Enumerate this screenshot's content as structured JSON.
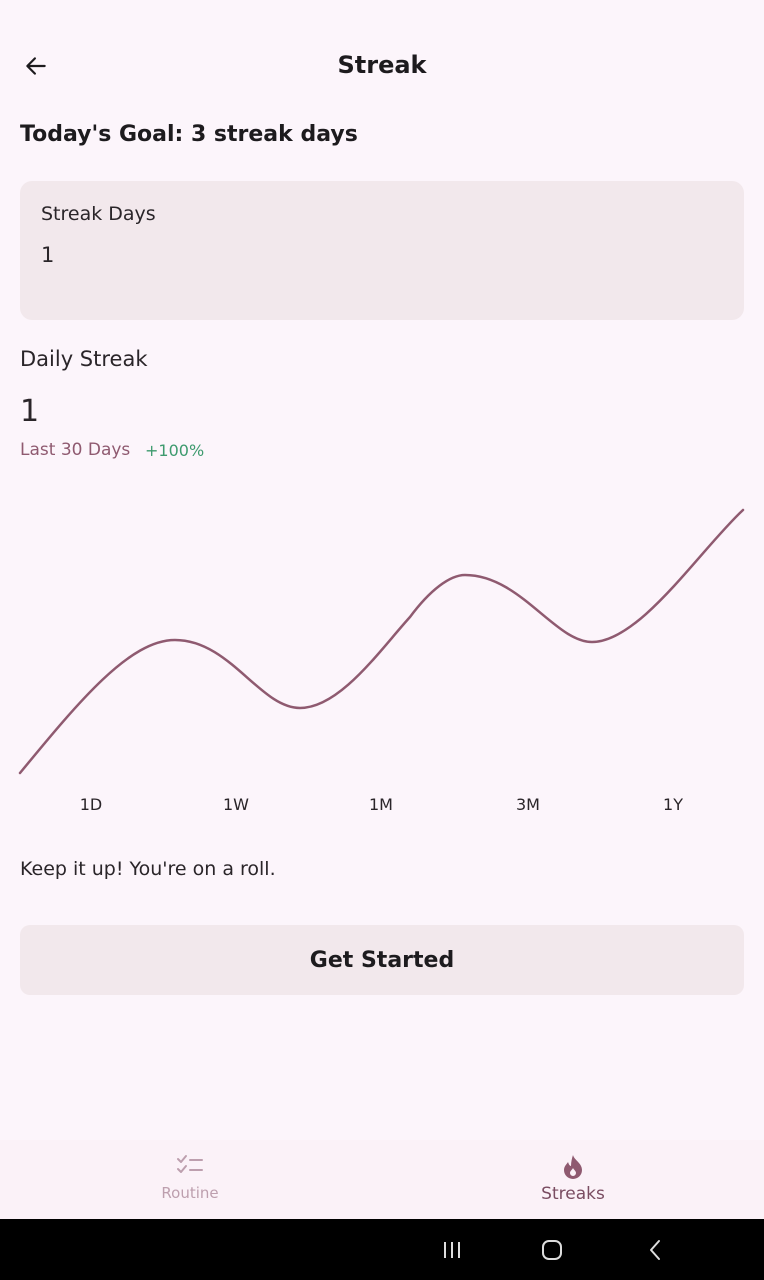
{
  "app_bar": {
    "title": "Streak"
  },
  "goal": {
    "text": "Today's Goal: 3 streak days"
  },
  "streak_card": {
    "label": "Streak Days",
    "value": "1"
  },
  "daily": {
    "label": "Daily Streak",
    "value": "1",
    "period": "Last 30 Days",
    "change": "+100%"
  },
  "chart_data": {
    "type": "line",
    "title": "",
    "xlabel": "",
    "ylabel": "",
    "grid": false,
    "categories": [
      "1D",
      "1W",
      "1M",
      "3M",
      "1Y"
    ],
    "color": "#8f5a70"
  },
  "message": "Keep it up! You're on a roll.",
  "cta": {
    "label": "Get Started"
  },
  "bottom_nav": {
    "items": [
      {
        "label": "Routine",
        "icon": "checklist-icon",
        "active": false
      },
      {
        "label": "Streaks",
        "icon": "flame-icon",
        "active": true
      }
    ]
  },
  "system_nav": {
    "icons": [
      "recents-icon",
      "home-icon",
      "back-icon"
    ]
  },
  "colors": {
    "background": "#fcf5fb",
    "card": "#f2e8ec",
    "accent": "#8f5a70",
    "positive": "#3d9a6e"
  }
}
